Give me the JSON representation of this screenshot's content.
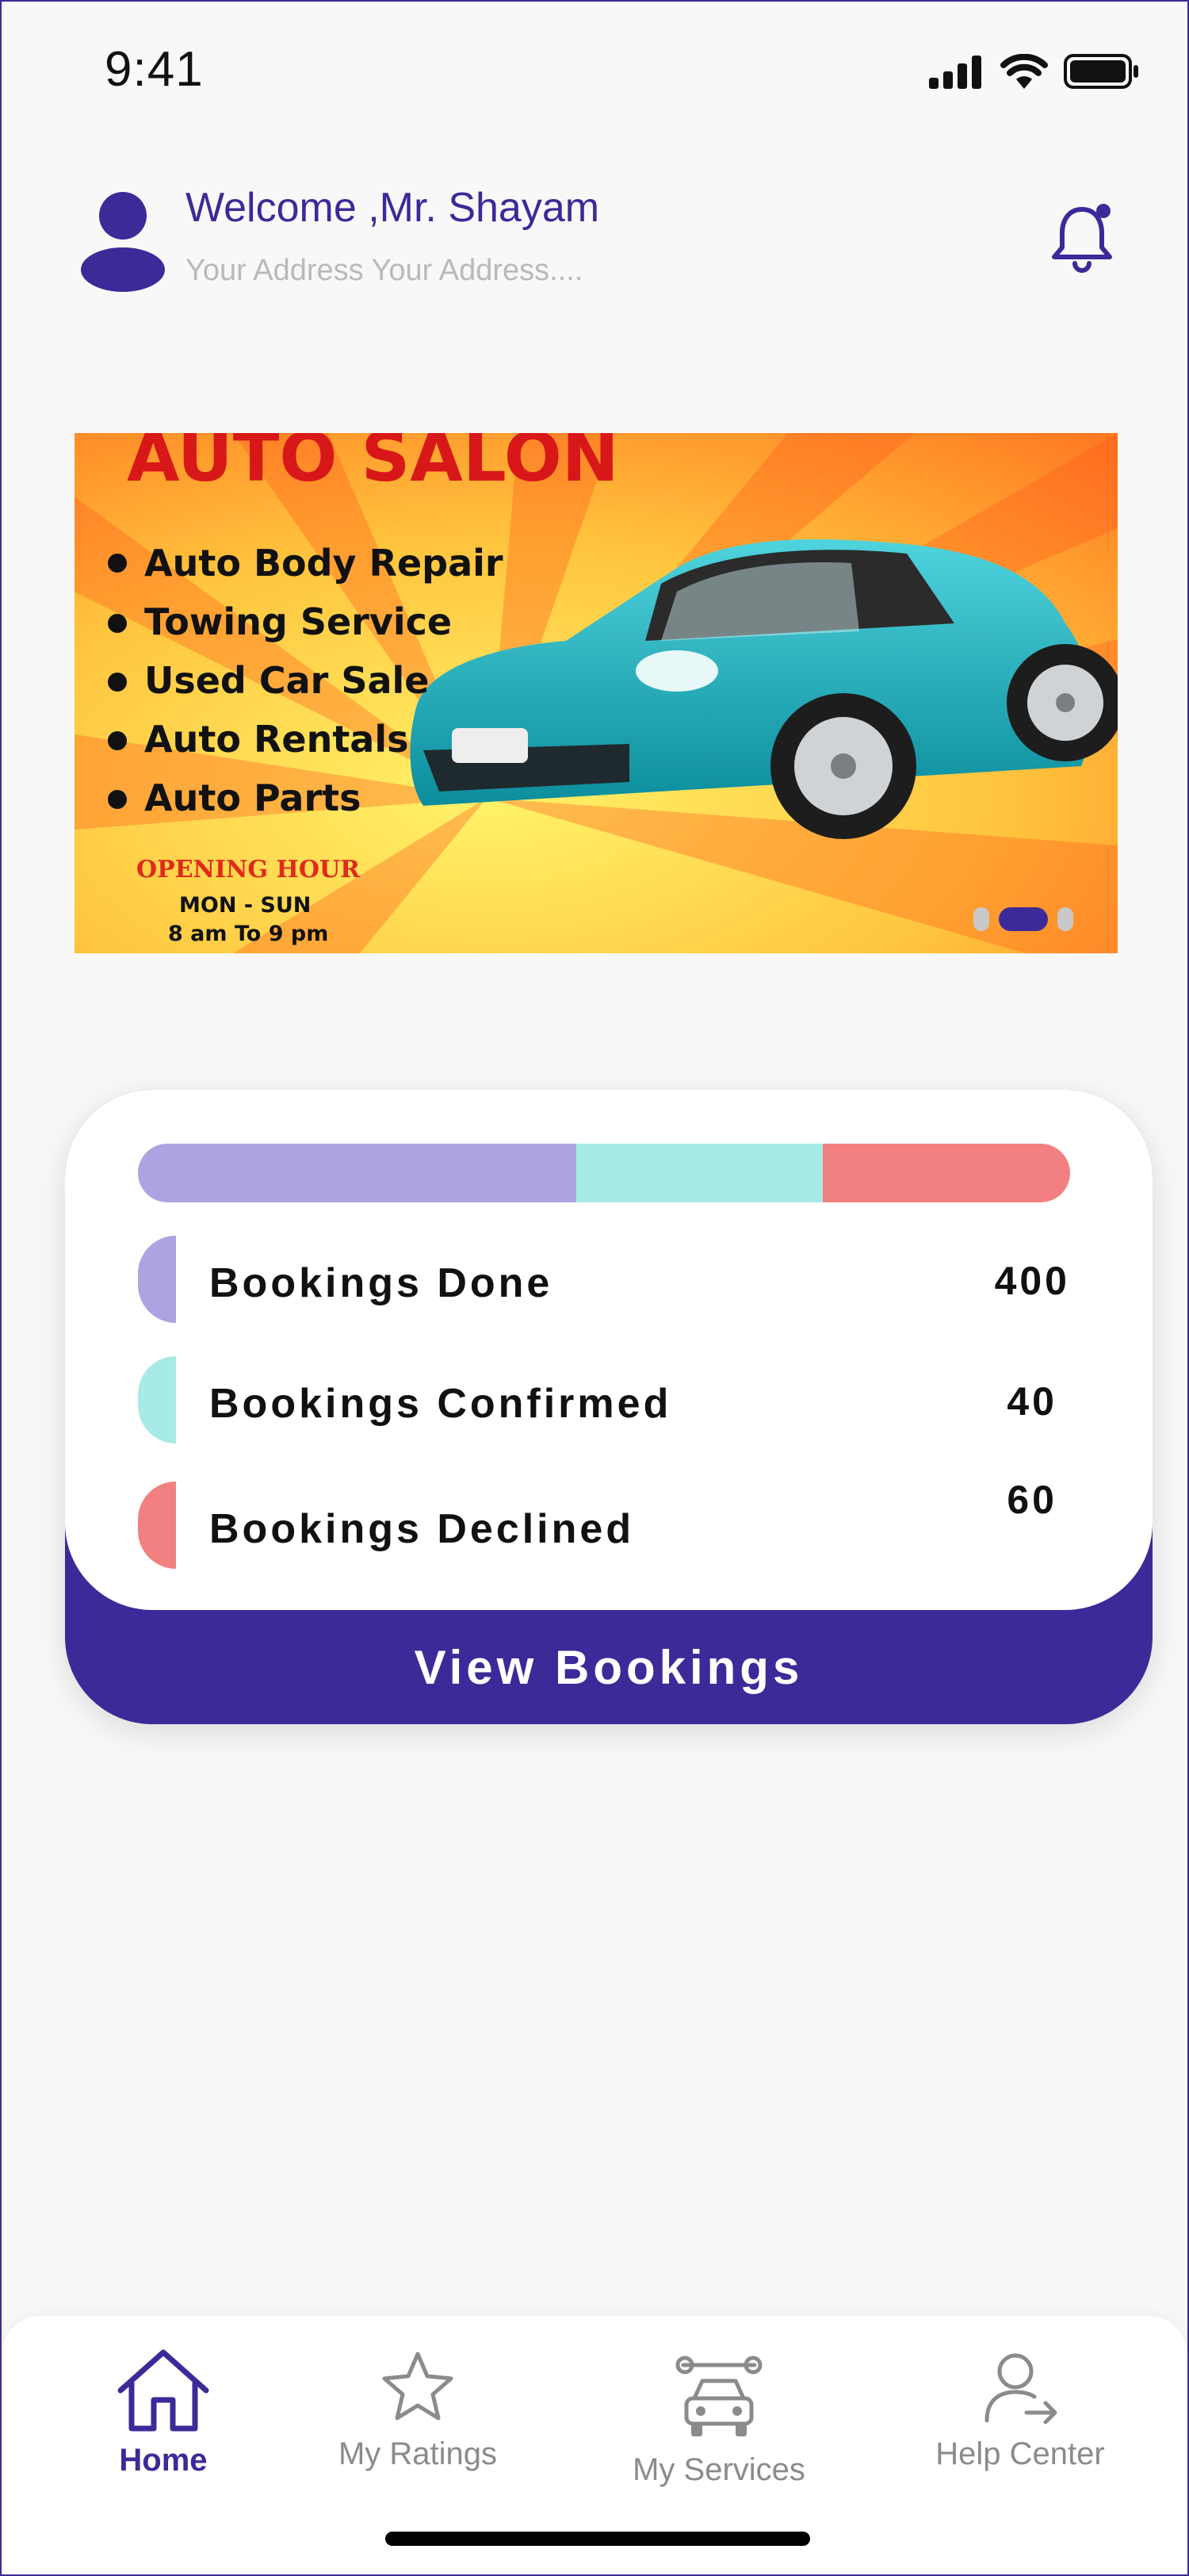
{
  "status_bar": {
    "time": "9:41"
  },
  "header": {
    "welcome": "Welcome ,Mr. Shayam",
    "address": "Your Address Your Address....",
    "icons": {
      "avatar": "user-avatar-icon",
      "notifications": "bell-icon"
    }
  },
  "banner": {
    "title": "AUTO SALON",
    "services": [
      "Auto Body Repair",
      "Towing Service",
      "Used Car Sale",
      "Auto Rentals",
      "Auto Parts"
    ],
    "hours_title": "OPENING HOUR",
    "days": "MON - SUN",
    "hours": "8 am To 9 pm",
    "carousel": {
      "count": 3,
      "active_index": 1
    }
  },
  "stats": {
    "items": [
      {
        "label": "Bookings Done",
        "value": "400",
        "color": "#ada3e2"
      },
      {
        "label": "Bookings Confirmed",
        "value": "40",
        "color": "#a8ebe6"
      },
      {
        "label": "Bookings Declined",
        "value": "60",
        "color": "#f28080"
      }
    ],
    "button_label": "View Bookings",
    "accent": "#3c2a98"
  },
  "tabs": [
    {
      "label": "Home",
      "icon": "home-icon",
      "active": true
    },
    {
      "label": "My Ratings",
      "icon": "star-icon",
      "active": false
    },
    {
      "label": "My Services",
      "icon": "car-service-icon",
      "active": false
    },
    {
      "label": "Help Center",
      "icon": "help-user-icon",
      "active": false
    }
  ]
}
